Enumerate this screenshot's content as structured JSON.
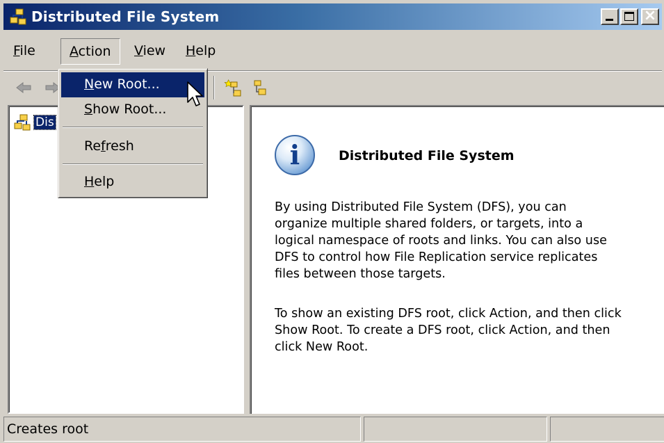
{
  "window": {
    "title": "Distributed File System",
    "app_icon": "dfs-icon"
  },
  "menubar": {
    "items": [
      {
        "label": "File",
        "mnemonic": "F",
        "rest": "ile"
      },
      {
        "label": "Action",
        "mnemonic": "A",
        "rest": "ction"
      },
      {
        "label": "View",
        "mnemonic": "V",
        "rest": "iew"
      },
      {
        "label": "Help",
        "mnemonic": "H",
        "rest": "elp"
      }
    ]
  },
  "dropdown": {
    "items": [
      {
        "label": "New Root...",
        "pre": "",
        "mnemonic": "N",
        "post": "ew Root..."
      },
      {
        "label": "Show Root...",
        "pre": "",
        "mnemonic": "S",
        "post": "how Root..."
      },
      {
        "label": "Refresh",
        "pre": "Re",
        "mnemonic": "f",
        "post": "resh"
      },
      {
        "label": "Help",
        "pre": "",
        "mnemonic": "H",
        "post": "elp"
      }
    ]
  },
  "tree": {
    "root_label": "Dis"
  },
  "info": {
    "title": "Distributed File System",
    "para1": "By using Distributed File System (DFS), you can organize multiple shared folders, or targets, into a logical namespace of roots and links. You can also use DFS to control how File Replication service replicates files between those targets.",
    "para2": "To show an existing DFS root, click Action, and then click Show Root. To create a DFS root, click Action, and then click New Root."
  },
  "statusbar": {
    "text": "Creates root"
  },
  "colors": {
    "title_start": "#0a246a",
    "title_end": "#a6caf0",
    "highlight": "#0a246a",
    "face": "#d4d0c8"
  }
}
